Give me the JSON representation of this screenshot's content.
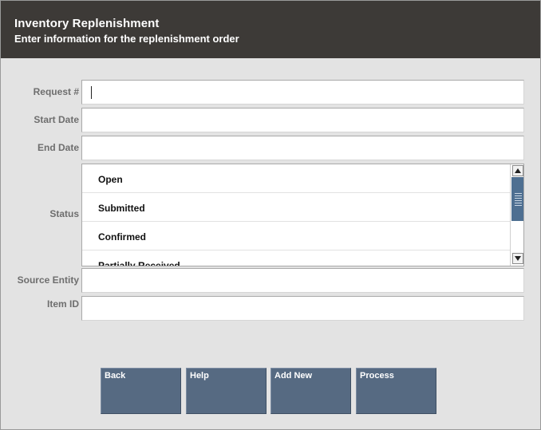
{
  "header": {
    "title": "Inventory Replenishment",
    "subtitle": "Enter information for the replenishment order"
  },
  "form": {
    "request_label": "Request #",
    "request_value": "",
    "start_date_label": "Start Date",
    "start_date_value": "",
    "end_date_label": "End Date",
    "end_date_value": "",
    "status_label": "Status",
    "status_options": [
      "Open",
      "Submitted",
      "Confirmed",
      "Partially Received"
    ],
    "source_entity_label": "Source Entity",
    "source_entity_value": "",
    "item_id_label": "Item ID",
    "item_id_value": ""
  },
  "buttons": {
    "back": "Back",
    "help": "Help",
    "add_new": "Add New",
    "process": "Process"
  },
  "colors": {
    "header_bg": "#3d3a37",
    "button_bg": "#566a82",
    "scroll_thumb": "#4e6f91",
    "window_bg": "#e3e3e3"
  }
}
